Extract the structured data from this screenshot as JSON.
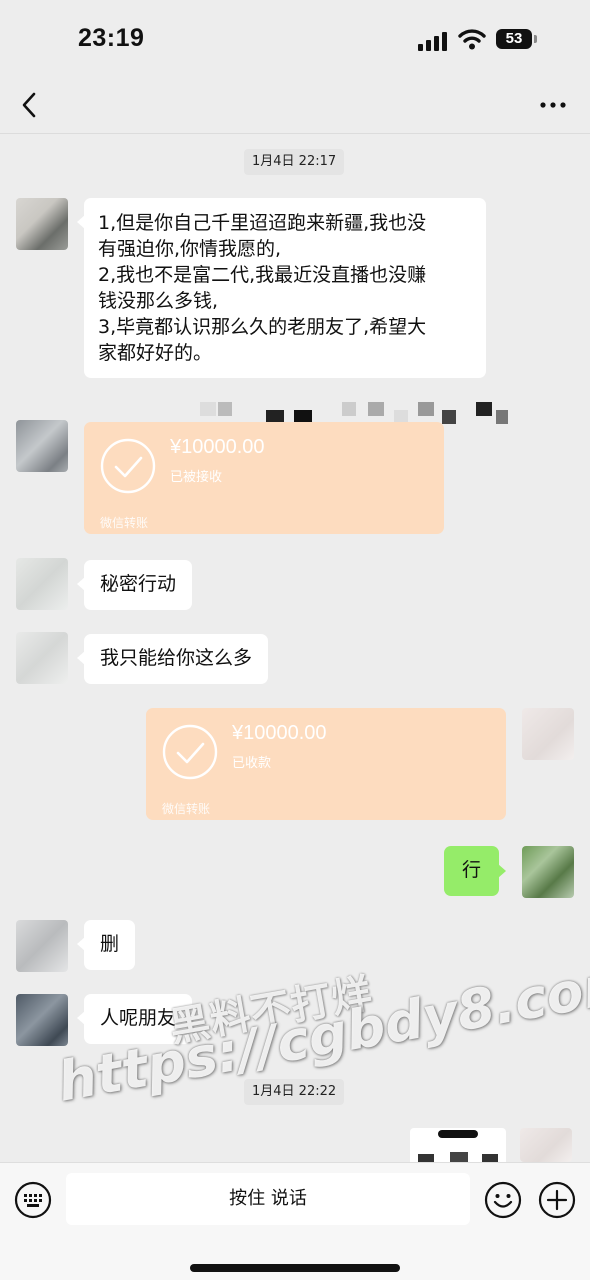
{
  "status_bar": {
    "time": "23:19",
    "battery": "53"
  },
  "nav": {
    "title": ""
  },
  "timestamps": [
    "1月4日 22:17",
    "1月4日 22:22"
  ],
  "messages": {
    "m1": {
      "lines": [
        "1,但是你自己千里迢迢跑来新疆,我也没",
        "有强迫你,你情我愿的,",
        "2,我也不是富二代,我最近没直播也没赚",
        "钱没那么多钱,",
        "3,毕竟都认识那么久的老朋友了,希望大",
        "家都好好的。"
      ]
    },
    "transfer_in": {
      "amount": "¥10000.00",
      "status": "已被接收",
      "source": "微信转账"
    },
    "m3": "秘密行动",
    "m4": "我只能给你这么多",
    "transfer_out": {
      "amount": "¥10000.00",
      "status": "已收款",
      "source": "微信转账"
    },
    "m6": "行",
    "m7": "删",
    "m8": "人呢朋友"
  },
  "watermark": {
    "line1": "黑料不打烊",
    "line2": "https://cgbdy8.com"
  },
  "input_bar": {
    "hold_to_talk": "按住 说话"
  },
  "icons": [
    "back-icon",
    "more-icon",
    "signal-icon",
    "wifi-icon",
    "battery-icon",
    "check-circle-icon",
    "keyboard-icon",
    "emoji-icon",
    "plus-icon"
  ],
  "colors": {
    "background": "#ededed",
    "my_bubble": "#95ec69",
    "transfer_card": "#fddcbf"
  }
}
